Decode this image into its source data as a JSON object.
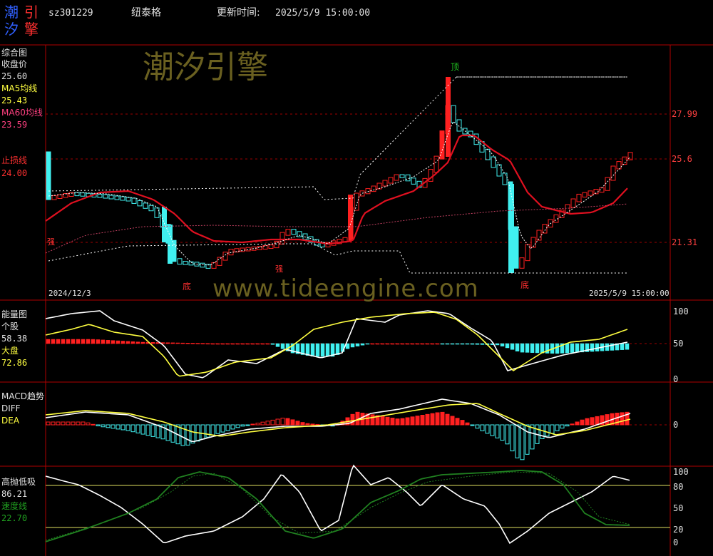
{
  "header": {
    "logo_chars": [
      "潮",
      "引",
      "汐",
      "擎"
    ],
    "code": "sz301229",
    "name": "纽泰格",
    "update_label": "更新时间:",
    "update_time": "2025/5/9 15:00:00"
  },
  "watermarks": {
    "main": "潮汐引擎",
    "url": "www.tideengine.com"
  },
  "main_panel": {
    "title": "综合图",
    "close_label": "收盘价",
    "close_value": "25.60",
    "ma5_label": "MA5均线",
    "ma5_value": "25.43",
    "ma60_label": "MA60均线",
    "ma60_value": "23.59",
    "stop_label": "止损线",
    "stop_value": "24.00",
    "y_ticks": [
      "27.99",
      "25.6",
      "21.31"
    ],
    "date_start": "2024/12/3",
    "date_end": "2025/5/9 15:00:00",
    "marks": {
      "top": "顶",
      "bottom1": "底",
      "bottom2": "底",
      "strong1": "强",
      "strong2": "强"
    }
  },
  "energy_panel": {
    "title": "能量图",
    "stock_label": "个股",
    "stock_value": "58.38",
    "market_label": "大盘",
    "market_value": "72.86",
    "y_ticks": [
      "100",
      "50",
      "0"
    ]
  },
  "macd_panel": {
    "title": "MACD趋势",
    "diff_label": "DIFF",
    "dea_label": "DEA",
    "y_ticks": [
      "0"
    ]
  },
  "osc_panel": {
    "title": "高抛低吸",
    "value": "86.21",
    "speed_label": "速度线",
    "speed_value": "22.70",
    "y_ticks": [
      "100",
      "80",
      "50",
      "20",
      "0"
    ]
  },
  "colors": {
    "up": "#ff2020",
    "down": "#40f0f0",
    "border": "#b00000",
    "dash": "#a00000",
    "yellow": "#ffff40",
    "white": "#ffffff",
    "green": "#208020",
    "ma60": "#c04060",
    "watermark": "#6a6020",
    "axis_text": "#ff4040"
  }
}
